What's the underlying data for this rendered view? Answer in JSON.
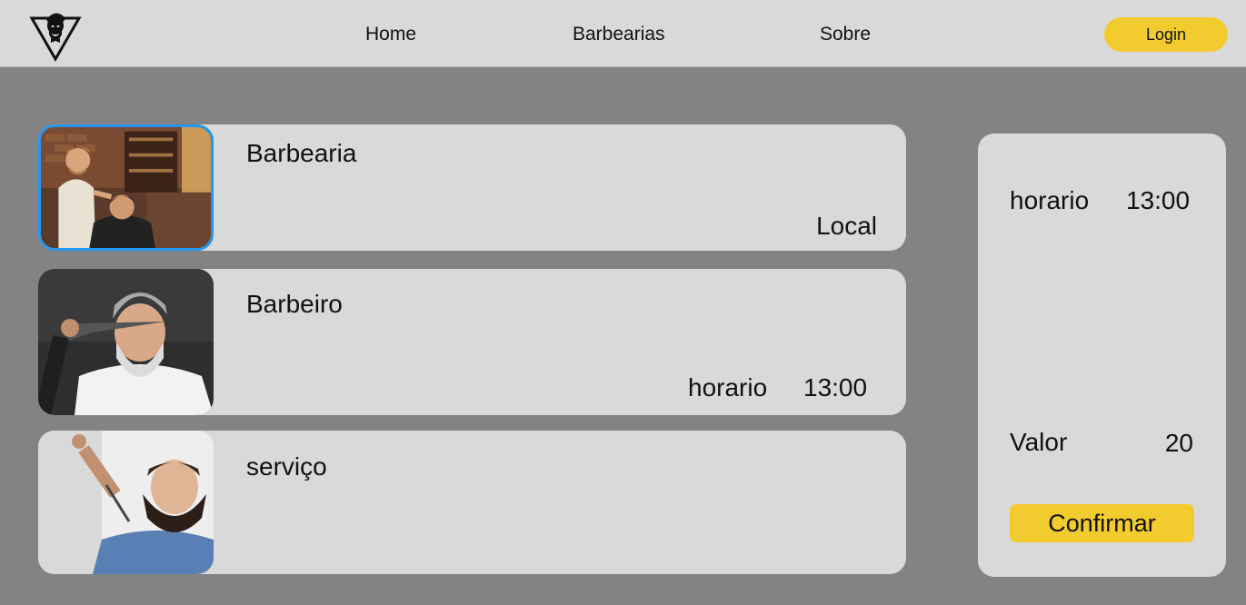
{
  "nav": {
    "logo_icon": "barber-logo-icon",
    "links": [
      "Home",
      "Barbearias",
      "Sobre"
    ],
    "login_label": "Login"
  },
  "cards": [
    {
      "title": "Barbearia",
      "detail": "Local",
      "image": "barbershop-photo"
    },
    {
      "title": "Barbeiro",
      "horario_label": "horario",
      "horario_value": "13:00",
      "image": "barber-photo"
    },
    {
      "title": "serviço",
      "image": "beard-trim-photo"
    }
  ],
  "summary": {
    "horario_label": "horario",
    "horario_value": "13:00",
    "valor_label": "Valor",
    "valor_value": "20",
    "confirm_label": "Confirmar"
  },
  "colors": {
    "background": "#838383",
    "panel": "#d9d9d9",
    "accent": "#f2cc2f",
    "selected_border": "#2196f3"
  }
}
